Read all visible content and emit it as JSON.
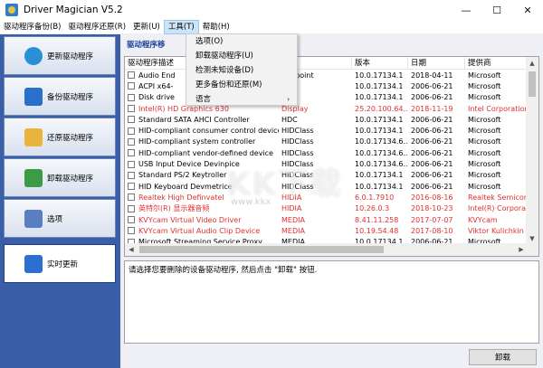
{
  "window": {
    "title": "Driver Magician V5.2",
    "minimize": "—",
    "maximize": "☐",
    "close": "✕"
  },
  "menubar": {
    "items": [
      "驱动程序备份(B)",
      "驱动程序还原(R)",
      "更新(U)",
      "工具(T)",
      "帮助(H)"
    ]
  },
  "tools_menu": {
    "items": [
      {
        "label": "选项(O)"
      },
      {
        "label": "卸载驱动程序(U)"
      },
      {
        "label": "检测未知设备(D)"
      },
      {
        "label": "更多备份和还原(M)"
      },
      {
        "label": "语言",
        "arrow": "›"
      }
    ]
  },
  "sidebar": {
    "items": [
      {
        "label": "更新驱动程序",
        "icon": "globe-update-icon",
        "color": "#2a8fd6"
      },
      {
        "label": "备份驱动程序",
        "icon": "backup-icon",
        "color": "#2a6fc9"
      },
      {
        "label": "还原驱动程序",
        "icon": "restore-folder-icon",
        "color": "#e8b43b"
      },
      {
        "label": "卸载驱动程序",
        "icon": "trash-icon",
        "color": "#3d9b46"
      },
      {
        "label": "选项",
        "icon": "options-check-icon",
        "color": "#5a7fc0"
      },
      {
        "label": "实时更新",
        "icon": "realtime-update-icon",
        "color": "#2d6fd0"
      }
    ]
  },
  "main": {
    "section_title": "驱动程序移",
    "columns": [
      "驱动程序描述",
      "",
      "版本",
      "日期",
      "提供商"
    ],
    "rows": [
      {
        "name": "Audio End",
        "cls": "Endpoint",
        "ver": "10.0.17134.1",
        "date": "2018-04-11",
        "prov": "Microsoft",
        "red": false
      },
      {
        "name": "ACPI x64-",
        "cls": "uter",
        "ver": "10.0.17134.1",
        "date": "2006-06-21",
        "prov": "Microsoft",
        "red": false
      },
      {
        "name": "Disk drive",
        "cls": "rive",
        "ver": "10.0.17134.1",
        "date": "2006-06-21",
        "prov": "Microsoft",
        "red": false
      },
      {
        "name": "Intel(R) HD Graphics 630",
        "cls": "Display",
        "ver": "25.20.100.64...",
        "date": "2018-11-19",
        "prov": "Intel Corporation",
        "red": true
      },
      {
        "name": "Standard SATA AHCI Controller",
        "cls": "HDC",
        "ver": "10.0.17134.1",
        "date": "2006-06-21",
        "prov": "Microsoft",
        "red": false
      },
      {
        "name": "HID-compliant consumer control device",
        "cls": "HIDClass",
        "ver": "10.0.17134.1",
        "date": "2006-06-21",
        "prov": "Microsoft",
        "red": false
      },
      {
        "name": "HID-compliant system controller",
        "cls": "HIDClass",
        "ver": "10.0.17134.6...",
        "date": "2006-06-21",
        "prov": "Microsoft",
        "red": false
      },
      {
        "name": "HID-compliant vendor-defined device",
        "cls": "HIDClass",
        "ver": "10.0.17134.6...",
        "date": "2006-06-21",
        "prov": "Microsoft",
        "red": false
      },
      {
        "name": "USB Input Device Devinpice",
        "cls": "HIDClass",
        "ver": "10.0.17134.6...",
        "date": "2006-06-21",
        "prov": "Microsoft",
        "red": false
      },
      {
        "name": "Standard PS/2 Keytroller",
        "cls": "HIDClass",
        "ver": "10.0.17134.1",
        "date": "2006-06-21",
        "prov": "Microsoft",
        "red": false
      },
      {
        "name": "HID Keyboard Devmetrice",
        "cls": "HIDClass",
        "ver": "10.0.17134.1",
        "date": "2006-06-21",
        "prov": "Microsoft",
        "red": false
      },
      {
        "name": "Realtek High Definvatel",
        "cls": "HIDIA",
        "ver": "6.0.1.7910",
        "date": "2016-08-16",
        "prov": "Realtek Semicond",
        "red": true
      },
      {
        "name": "英特尔(R) 显示器音频",
        "cls": "HIDIA",
        "ver": "10.26.0.3",
        "date": "2018-10-23",
        "prov": "Intel(R) Corporation",
        "red": true
      },
      {
        "name": "KVYcam Virtual Video Driver",
        "cls": "MEDIA",
        "ver": "8.41.11.258",
        "date": "2017-07-07",
        "prov": "KVYcam",
        "red": true
      },
      {
        "name": "KVYcam Virtual Audio Clip Device",
        "cls": "MEDIA",
        "ver": "10.19.54.48",
        "date": "2017-08-10",
        "prov": "Viktor Kulichkin",
        "red": true
      },
      {
        "name": "Microsoft Streaming Service Proxy",
        "cls": "MEDIA",
        "ver": "10.0.17134.1",
        "date": "2006-06-21",
        "prov": "Microsoft",
        "red": false
      }
    ],
    "info_text": "请选择您要删除的设备驱动程序, 然后点击 \"卸载\" 按钮.",
    "uninstall_label": "卸载"
  },
  "watermark": {
    "text": "KK下载",
    "sub": "www.kkx"
  }
}
